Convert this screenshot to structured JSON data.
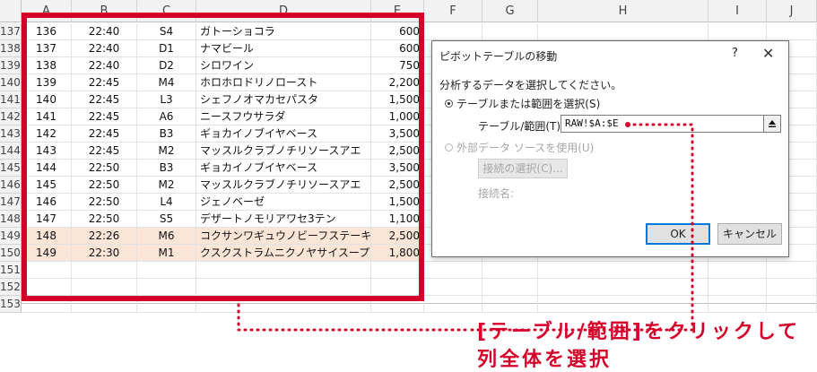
{
  "sheet": {
    "columns": [
      "A",
      "B",
      "C",
      "D",
      "E",
      "F",
      "G",
      "H",
      "I",
      "J"
    ],
    "rows": [
      {
        "num": "137",
        "cells": [
          "136",
          "22:40",
          "S4",
          "ガトーショコラ",
          "600"
        ],
        "highlight": false
      },
      {
        "num": "138",
        "cells": [
          "137",
          "22:40",
          "D1",
          "ナマビール",
          "600"
        ],
        "highlight": false
      },
      {
        "num": "139",
        "cells": [
          "138",
          "22:40",
          "D2",
          "シロワイン",
          "750"
        ],
        "highlight": false
      },
      {
        "num": "140",
        "cells": [
          "139",
          "22:45",
          "M4",
          "ホロホロドリノロースト",
          "2,200"
        ],
        "highlight": false
      },
      {
        "num": "141",
        "cells": [
          "140",
          "22:45",
          "L3",
          "シェフノオマカセパスタ",
          "1,500"
        ],
        "highlight": false
      },
      {
        "num": "142",
        "cells": [
          "141",
          "22:45",
          "A6",
          "ニースフウサラダ",
          "1,000"
        ],
        "highlight": false
      },
      {
        "num": "143",
        "cells": [
          "142",
          "22:45",
          "B3",
          "ギョカイノブイヤベース",
          "3,500"
        ],
        "highlight": false
      },
      {
        "num": "144",
        "cells": [
          "143",
          "22:45",
          "M2",
          "マッスルクラブノチリソースアエ",
          "2,500"
        ],
        "highlight": false
      },
      {
        "num": "145",
        "cells": [
          "144",
          "22:50",
          "B3",
          "ギョカイノブイヤベース",
          "3,500"
        ],
        "highlight": false
      },
      {
        "num": "146",
        "cells": [
          "145",
          "22:50",
          "M2",
          "マッスルクラブノチリソースアエ",
          "2,500"
        ],
        "highlight": false
      },
      {
        "num": "147",
        "cells": [
          "146",
          "22:50",
          "L4",
          "ジェノベーゼ",
          "1,500"
        ],
        "highlight": false
      },
      {
        "num": "148",
        "cells": [
          "147",
          "22:50",
          "S5",
          "デザートノモリアワセ3テン",
          "1,100"
        ],
        "highlight": false
      },
      {
        "num": "149",
        "cells": [
          "148",
          "22:26",
          "M6",
          "コクサンワギュウノビーフステーキ",
          "2,500"
        ],
        "highlight": true
      },
      {
        "num": "150",
        "cells": [
          "149",
          "22:30",
          "M1",
          "クスクストラムニクノヤサイスープ",
          "1,800"
        ],
        "highlight": true
      },
      {
        "num": "151",
        "cells": [
          "",
          "",
          "",
          "",
          ""
        ],
        "highlight": false
      },
      {
        "num": "152",
        "cells": [
          "",
          "",
          "",
          "",
          ""
        ],
        "highlight": false
      },
      {
        "num": "153",
        "cells": [
          "",
          "",
          "",
          "",
          ""
        ],
        "highlight": false
      }
    ],
    "highlight_color": "#fbe5d6",
    "selection_border_color": "#d5002a"
  },
  "dialog": {
    "title": "ピボットテーブルの移動",
    "help_label": "?",
    "close_label": "✕",
    "prompt": "分析するデータを選択してください。",
    "option_table_label": "テーブルまたは範囲を選択(S)",
    "range_label": "テーブル/範囲(T):",
    "range_value": "RAW!$A:$E",
    "option_external_label": "外部データ ソースを使用(U)",
    "connection_button_label": "接続の選択(C)...",
    "connection_name_label": "接続名:",
    "ok_label": "OK",
    "cancel_label": "キャンセル",
    "collapse_icon": "range-collapse-icon"
  },
  "annotation": {
    "line1": "[テーブル/範囲]をクリックして",
    "line2": "列全体を選択",
    "color": "#d5002a"
  }
}
